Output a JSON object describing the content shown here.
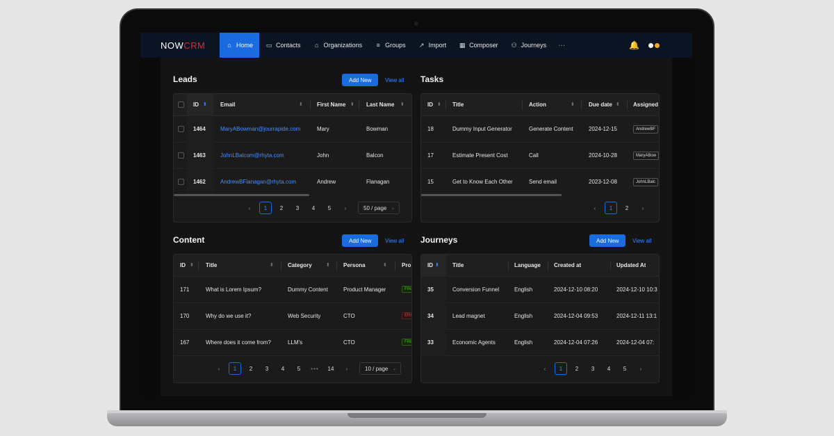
{
  "nav": {
    "logo_now": "NOW",
    "logo_crm": "CRM",
    "items": [
      {
        "label": "Home",
        "icon": "home-icon",
        "glyph": "⌂"
      },
      {
        "label": "Contacts",
        "icon": "id-card-icon",
        "glyph": "▭"
      },
      {
        "label": "Organizations",
        "icon": "bank-icon",
        "glyph": "⌂"
      },
      {
        "label": "Groups",
        "icon": "list-icon",
        "glyph": "≡"
      },
      {
        "label": "Import",
        "icon": "import-icon",
        "glyph": "↗"
      },
      {
        "label": "Composer",
        "icon": "composer-icon",
        "glyph": "▦"
      },
      {
        "label": "Journeys",
        "icon": "journeys-icon",
        "glyph": "⚇"
      }
    ],
    "more": "···",
    "bell_glyph": "🔔",
    "status_colors": [
      "#ffffff",
      "#f5a623"
    ]
  },
  "leads": {
    "title": "Leads",
    "add_label": "Add New",
    "view_all": "View all",
    "columns": [
      "ID",
      "Email",
      "First Name",
      "Last Name"
    ],
    "rows": [
      {
        "id": "1464",
        "email": "MaryABowman@jourrapide.com",
        "first": "Mary",
        "last": "Bowman"
      },
      {
        "id": "1463",
        "email": "JohnLBalcom@rhyta.com",
        "first": "John",
        "last": "Balcon"
      },
      {
        "id": "1462",
        "email": "AndrewBFlanagan@rhyta.com",
        "first": "Andrew",
        "last": "Flanagan"
      }
    ],
    "pages": [
      "1",
      "2",
      "3",
      "4",
      "5"
    ],
    "page_size": "50 / page"
  },
  "tasks": {
    "title": "Tasks",
    "columns": [
      "ID",
      "Title",
      "Action",
      "Due date",
      "Assigned"
    ],
    "rows": [
      {
        "id": "18",
        "title": "Dummy Input Generator",
        "action": "Generate Content",
        "due": "2024-12-15",
        "assigned": "AndrewBF"
      },
      {
        "id": "17",
        "title": "Estimate Present Cost",
        "action": "Call",
        "due": "2024-10-28",
        "assigned": "MaryABow"
      },
      {
        "id": "15",
        "title": "Get to Know Each Other",
        "action": "Send email",
        "due": "2023-12-08",
        "assigned": "JohnLBalc"
      }
    ],
    "pages": [
      "1",
      "2"
    ]
  },
  "content": {
    "title": "Content",
    "add_label": "Add New",
    "view_all": "View all",
    "columns": [
      "ID",
      "Title",
      "Category",
      "Persona",
      "Pro"
    ],
    "rows": [
      {
        "id": "171",
        "title": "What is Lorem Ipsum?",
        "category": "Dummy Content",
        "persona": "Product Manager",
        "status": "FIN",
        "status_color": "green"
      },
      {
        "id": "170",
        "title": "Why do we use it?",
        "category": "Web Security",
        "persona": "CTO",
        "status": "ERI",
        "status_color": "red"
      },
      {
        "id": "167",
        "title": "Where does it come from?",
        "category": "LLM's",
        "persona": "CTO",
        "status": "FIN",
        "status_color": "green"
      }
    ],
    "pages": [
      "1",
      "2",
      "3",
      "4",
      "5"
    ],
    "ellipsis": "•••",
    "last_page": "14",
    "page_size": "10 / page"
  },
  "journeys": {
    "title": "Journeys",
    "add_label": "Add New",
    "view_all": "View all",
    "columns": [
      "ID",
      "Title",
      "Language",
      "Created at",
      "Updated At"
    ],
    "rows": [
      {
        "id": "35",
        "title": "Conversion Funnel",
        "language": "English",
        "created": "2024-12-10 08:20",
        "updated": "2024-12-10 10:3"
      },
      {
        "id": "34",
        "title": "Lead magnet",
        "language": "English",
        "created": "2024-12-04 09:53",
        "updated": "2024-12-11 13:1"
      },
      {
        "id": "33",
        "title": "Economic Agents",
        "language": "English",
        "created": "2024-12-04 07:26",
        "updated": "2024-12-04 07:"
      }
    ],
    "pages": [
      "1",
      "2",
      "3",
      "4",
      "5"
    ]
  },
  "accent": "#1a6be0"
}
